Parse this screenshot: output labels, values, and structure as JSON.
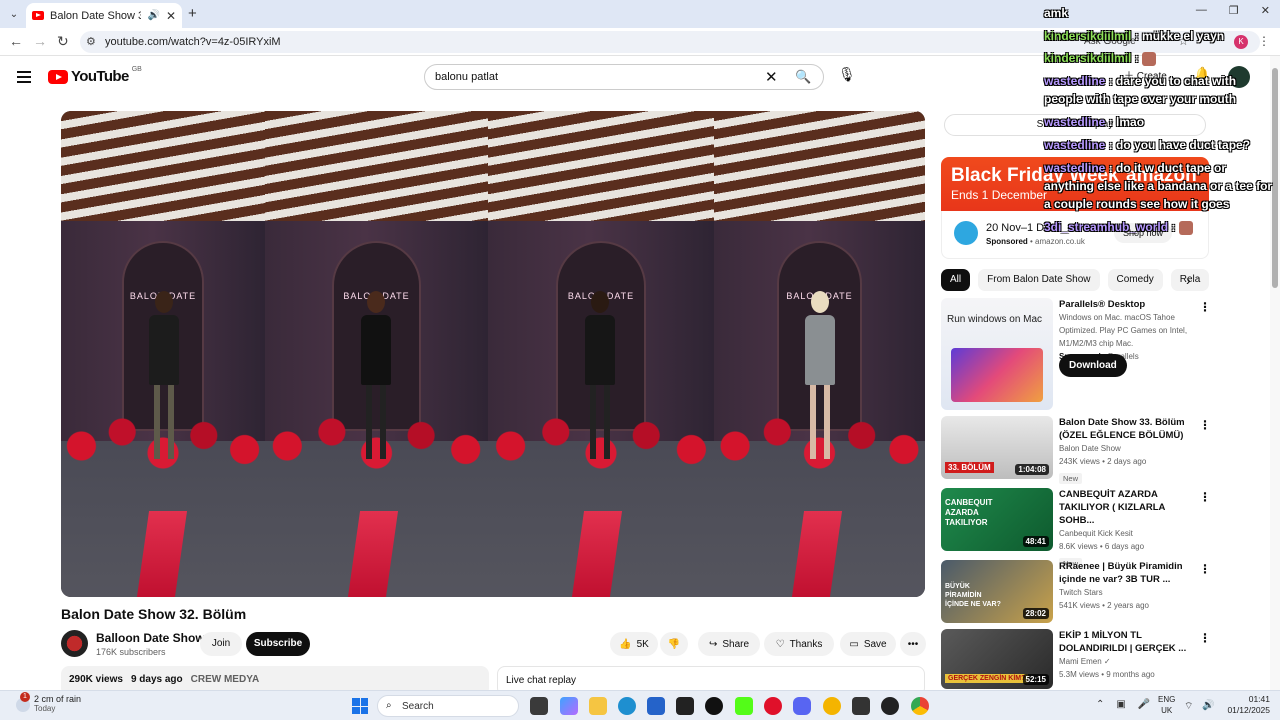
{
  "browser": {
    "tab_title": "Balon Date Show 32. Bölüm",
    "tab_audio": "🔊",
    "tab_close": "✕",
    "new_tab": "+",
    "url": "youtube.com/watch?v=4z-05IRYxiM",
    "ask_google": "Ask Google"
  },
  "header": {
    "logo_text": "YouTube",
    "country_code": "GB",
    "search_query": "balonu patlat",
    "create_label": "Create"
  },
  "video": {
    "title": "Balon Date Show 32. Bölüm",
    "channel_name": "Balloon Date Show",
    "subscribers": "176K subscribers",
    "join_label": "Join",
    "subscribe_label": "Subscribe",
    "likes": "5K",
    "share_label": "Share",
    "thanks_label": "Thanks",
    "save_label": "Save",
    "views": "290K views",
    "age": "9 days ago",
    "tag": "CREW MEDYA",
    "live_chat_replay": "Live chat replay",
    "neon_sign": "BALON DATE"
  },
  "sidebar": {
    "show_chat_replay": "Show chat replay",
    "ad": {
      "headline": "Black Friday Week",
      "subline": "Ends 1 December",
      "brand": "amazon",
      "dates": "20 Nov–1 Dec",
      "sponsored": "Sponsored",
      "domain": "amazon.co.uk",
      "shop_label": "Shop now"
    },
    "chips": [
      "All",
      "From Balon Date Show",
      "Comedy",
      "Rela"
    ],
    "recommendations": [
      {
        "title": "Parallels® Desktop",
        "desc": "Windows on Mac. macOS Tahoe Optimized. Play PC Games on Intel, M1/M2/M3 chip Mac.",
        "sponsored": "Sponsored",
        "advertiser": "Parallels",
        "cta": "Download",
        "thumb_text": "Run windows on Mac"
      },
      {
        "title": "Balon Date Show 33. Bölüm (ÖZEL EĞLENCE BÖLÜMÜ)",
        "channel": "Balon Date Show",
        "meta": "243K views • 2 days ago",
        "badge": "New",
        "duration": "1:04:08",
        "thumb_text": "33. BÖLÜM"
      },
      {
        "title": "CANBEQUİT AZARDA TAKILIYOR ( KIZLARLA SOHB...",
        "channel": "Canbequit Kick Kesit",
        "meta": "8.6K views • 6 days ago",
        "badge": "New",
        "duration": "48:41",
        "thumb_text": "CANBEQUIT AZARDA TAKILIYOR"
      },
      {
        "title": "RRaenee | Büyük Piramidin içinde ne var? 3B TUR ...",
        "channel": "Twitch Stars",
        "meta": "541K views • 2 years ago",
        "duration": "28:02",
        "thumb_text": "BÜYÜK PİRAMİDİN İÇİNDE NE VAR?"
      },
      {
        "title": "EKİP 1 MİLYON TL DOLANDIRILDI | GERÇEK ...",
        "channel": "Mami Emen ✓",
        "meta": "5.3M views • 9 months ago",
        "duration": "52:15",
        "thumb_text": "GERÇEK ZENGİN KİM?"
      }
    ]
  },
  "chat_overlay": [
    {
      "user": "",
      "message": "amk"
    },
    {
      "user": "kindersikdiilmil",
      "message": ": mükke el yayn",
      "color": "green"
    },
    {
      "user": "kindersikdiilmil",
      "message": ":",
      "color": "green",
      "emote": true
    },
    {
      "user": "wastedline",
      "message": ": dare you to chat with people with tape over your mouth",
      "color": "purple"
    },
    {
      "user": "wastedline",
      "message": ": lmao",
      "color": "purple"
    },
    {
      "user": "wastedline",
      "message": ": do you have duct tape?",
      "color": "purple"
    },
    {
      "user": "wastedline",
      "message": ": do it w duct tape or anything else like a bandana or a tee for a couple rounds see how it goes",
      "color": "purple"
    },
    {
      "user": "3di_streamhub_world",
      "message": ":",
      "color": "purple",
      "emote": true
    }
  ],
  "taskbar": {
    "weather_title": "2 cm of rain",
    "weather_sub": "Today",
    "notification_count": "1",
    "search_label": "Search",
    "lang_1": "ENG",
    "lang_2": "UK",
    "time": "01:41",
    "date": "01/12/2025"
  }
}
